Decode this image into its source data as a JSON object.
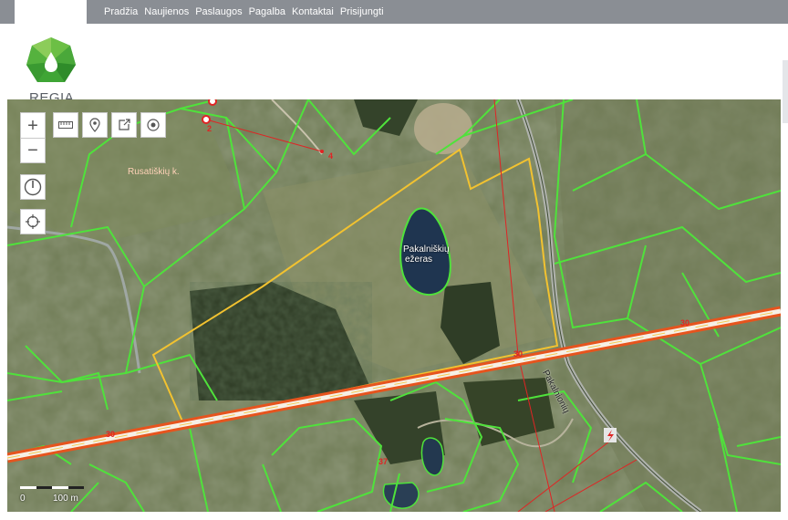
{
  "nav": {
    "items": [
      "Pradžia",
      "Naujienos",
      "Paslaugos",
      "Pagalba",
      "Kontaktai",
      "Prisijungti"
    ]
  },
  "brand": {
    "name": "REGIA",
    "logo_colors": [
      "#3fa535",
      "#7cc242"
    ]
  },
  "map": {
    "labels": {
      "village": "Rusatiškių k.",
      "lake_line1": "Pakalniškių",
      "lake_line2": "ežeras",
      "road_name": "Pakalnionių",
      "road_number_right": "30",
      "road_number_mid": "30",
      "road_number_left": "30",
      "parcel_number": "37",
      "point_2": "2",
      "point_4": "4"
    },
    "scale": {
      "start": "0",
      "end": "100 m"
    },
    "colors": {
      "parcel_boundary": "#4fe23b",
      "selected_parcel": "#f2c230",
      "road_fill": "#f6f0e6",
      "road_casing": "#e6541e",
      "red_line": "#e02424"
    }
  },
  "controls": {
    "zoom_in": "+",
    "zoom_out": "−",
    "icons": [
      "ruler-icon",
      "pin-icon",
      "share-icon",
      "target-icon",
      "compass-icon",
      "locate-icon"
    ]
  }
}
